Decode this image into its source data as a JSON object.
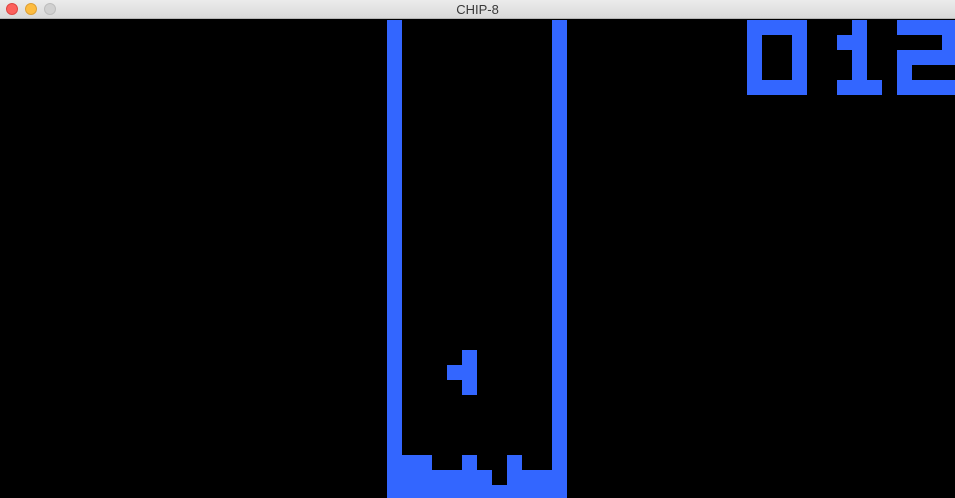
{
  "window": {
    "title": "CHIP-8",
    "controls": [
      "close",
      "minimize",
      "zoom"
    ]
  },
  "game": {
    "score": "012",
    "pixel_color": "#3366ff",
    "background_color": "#000000"
  }
}
